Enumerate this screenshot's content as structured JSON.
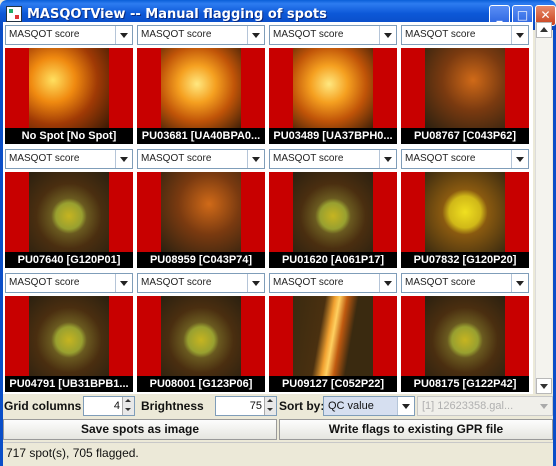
{
  "window": {
    "title": "MASQOTView -- Manual flagging of spots",
    "min_glyph": "_",
    "max_glyph": "□",
    "close_glyph": "✕"
  },
  "cells": [
    {
      "score": "MASQOT score",
      "label": "No Spot [No Spot]",
      "kind": "nospot"
    },
    {
      "score": "MASQOT score",
      "label": "PU03681 [UA40BPA0...",
      "kind": "bright"
    },
    {
      "score": "MASQOT score",
      "label": "PU03489 [UA37BPH0...",
      "kind": "bright"
    },
    {
      "score": "MASQOT score",
      "label": "PU08767 [C043P62]",
      "kind": "dim"
    },
    {
      "score": "MASQOT score",
      "label": "PU07640 [G120P01]",
      "kind": "spot"
    },
    {
      "score": "MASQOT score",
      "label": "PU08959 [C043P74]",
      "kind": "dim"
    },
    {
      "score": "MASQOT score",
      "label": "PU01620 [A061P17]",
      "kind": "spot"
    },
    {
      "score": "MASQOT score",
      "label": "PU07832 [G120P20]",
      "kind": "spotbright"
    },
    {
      "score": "MASQOT score",
      "label": "PU04791 [UB31BPB1...",
      "kind": "spot"
    },
    {
      "score": "MASQOT score",
      "label": "PU08001 [G123P06]",
      "kind": "spot"
    },
    {
      "score": "MASQOT score",
      "label": "PU09127 [C052P22]",
      "kind": "streak"
    },
    {
      "score": "MASQOT score",
      "label": "PU08175 [G122P42]",
      "kind": "spot"
    }
  ],
  "controls": {
    "grid_columns_label": "Grid columns",
    "grid_columns_value": "4",
    "brightness_label": "Brightness",
    "brightness_value": "75",
    "sort_label": "Sort by:",
    "sort_value": "QC value",
    "file_value": "[1] 12623358.gal..."
  },
  "buttons": {
    "save": "Save spots as image",
    "write": "Write flags to existing GPR file"
  },
  "status": "717 spot(s), 705 flagged.",
  "colors": {
    "title_bar": "#0a4ec8",
    "flag_red": "#c80000",
    "label_bg": "#000000"
  }
}
